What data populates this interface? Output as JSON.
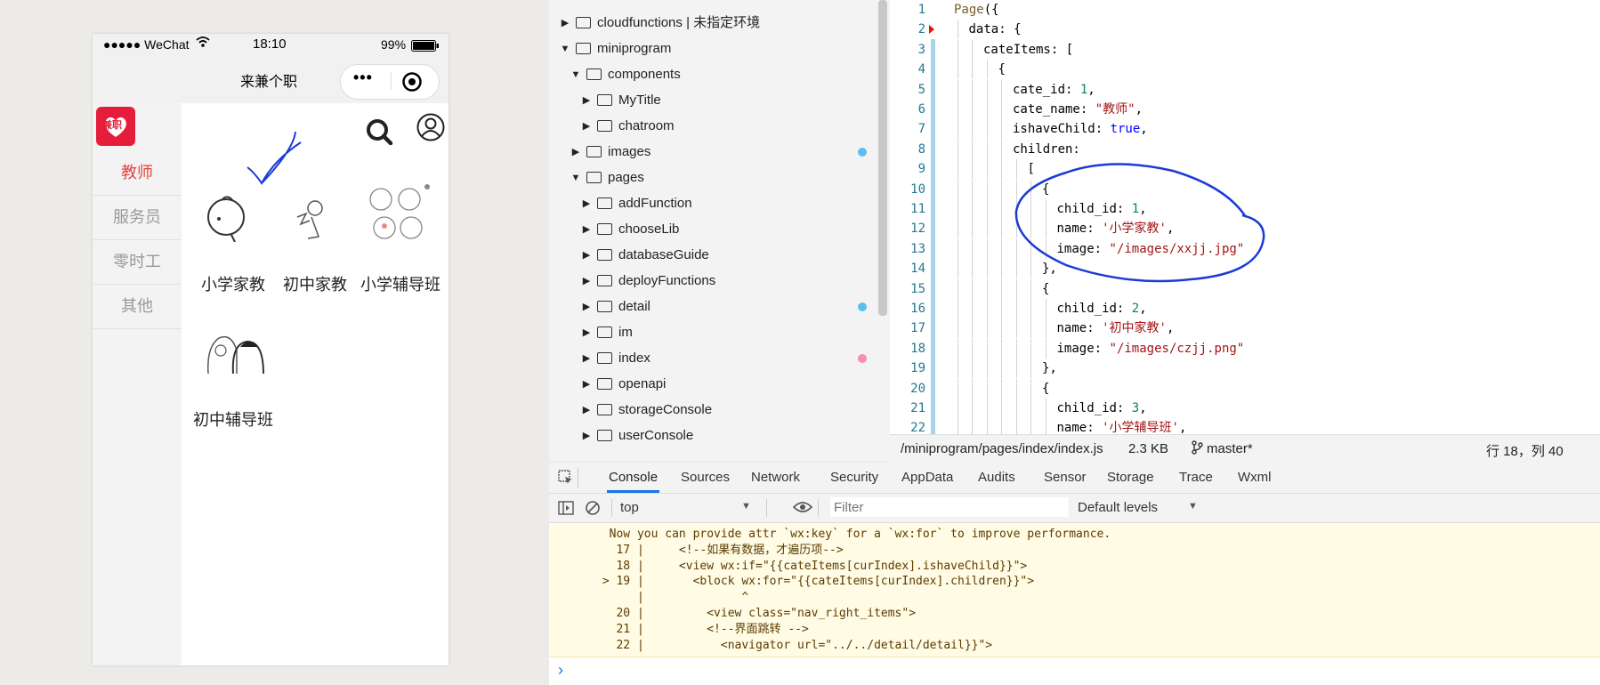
{
  "phone": {
    "status": {
      "carrier": "●●●●● WeChat",
      "time": "18:10",
      "battery": "99%"
    },
    "nav_title": "来兼个职",
    "capsule_more": "•••",
    "logo_text": "兼职",
    "sidebar": [
      "教师",
      "服务员",
      "零时工",
      "其他"
    ],
    "categories": [
      "小学家教",
      "初中家教",
      "小学辅导班",
      "初中辅导班"
    ],
    "colors": {
      "active": "#e64340",
      "inactive": "#999999"
    }
  },
  "tree": {
    "items": [
      {
        "label": "cloudfunctions | 未指定环境",
        "level": 0,
        "expanded": false
      },
      {
        "label": "miniprogram",
        "level": 0,
        "expanded": true
      },
      {
        "label": "components",
        "level": 1,
        "expanded": true
      },
      {
        "label": "MyTitle",
        "level": 2,
        "expanded": false
      },
      {
        "label": "chatroom",
        "level": 2,
        "expanded": false
      },
      {
        "label": "images",
        "level": 1,
        "expanded": false,
        "dot": "#5bc0f0"
      },
      {
        "label": "pages",
        "level": 1,
        "expanded": true
      },
      {
        "label": "addFunction",
        "level": 2,
        "expanded": false
      },
      {
        "label": "chooseLib",
        "level": 2,
        "expanded": false
      },
      {
        "label": "databaseGuide",
        "level": 2,
        "expanded": false
      },
      {
        "label": "deployFunctions",
        "level": 2,
        "expanded": false
      },
      {
        "label": "detail",
        "level": 2,
        "expanded": false,
        "dot": "#5bc0f0"
      },
      {
        "label": "im",
        "level": 2,
        "expanded": false
      },
      {
        "label": "index",
        "level": 2,
        "expanded": false,
        "dot": "#f48fb1"
      },
      {
        "label": "openapi",
        "level": 2,
        "expanded": false
      },
      {
        "label": "storageConsole",
        "level": 2,
        "expanded": false
      },
      {
        "label": "userConsole",
        "level": 2,
        "expanded": false
      }
    ]
  },
  "editor": {
    "lines": [
      {
        "num": "1",
        "indent": 0,
        "t": [
          [
            "fn",
            "Page"
          ],
          [
            "",
            "({"
          ]
        ]
      },
      {
        "num": "2",
        "indent": 1,
        "t": [
          [
            "",
            "data: {"
          ]
        ]
      },
      {
        "num": "3",
        "indent": 2,
        "t": [
          [
            "",
            "cateItems: ["
          ]
        ]
      },
      {
        "num": "4",
        "indent": 3,
        "t": [
          [
            "",
            "{"
          ]
        ]
      },
      {
        "num": "5",
        "indent": 4,
        "t": [
          [
            "",
            "cate_id: "
          ],
          [
            "n",
            "1"
          ],
          [
            "",
            ","
          ]
        ]
      },
      {
        "num": "6",
        "indent": 4,
        "t": [
          [
            "",
            "cate_name: "
          ],
          [
            "s",
            "\"教师\""
          ],
          [
            "",
            ","
          ]
        ]
      },
      {
        "num": "7",
        "indent": 4,
        "t": [
          [
            "",
            "ishaveChild: "
          ],
          [
            "k",
            "true"
          ],
          [
            "",
            ","
          ]
        ]
      },
      {
        "num": "8",
        "indent": 4,
        "t": [
          [
            "",
            "children:"
          ]
        ]
      },
      {
        "num": "9",
        "indent": 5,
        "t": [
          [
            "",
            "["
          ]
        ]
      },
      {
        "num": "10",
        "indent": 6,
        "t": [
          [
            "",
            "{"
          ]
        ]
      },
      {
        "num": "11",
        "indent": 7,
        "t": [
          [
            "",
            "child_id: "
          ],
          [
            "n",
            "1"
          ],
          [
            "",
            ","
          ]
        ]
      },
      {
        "num": "12",
        "indent": 7,
        "t": [
          [
            "",
            "name: "
          ],
          [
            "s",
            "'小学家教'"
          ],
          [
            "",
            ","
          ]
        ]
      },
      {
        "num": "13",
        "indent": 7,
        "t": [
          [
            "",
            "image: "
          ],
          [
            "s",
            "\"/images/xxjj.jpg\""
          ]
        ]
      },
      {
        "num": "14",
        "indent": 6,
        "t": [
          [
            "",
            "},"
          ]
        ]
      },
      {
        "num": "15",
        "indent": 6,
        "t": [
          [
            "",
            "{"
          ]
        ]
      },
      {
        "num": "16",
        "indent": 7,
        "t": [
          [
            "",
            "child_id: "
          ],
          [
            "n",
            "2"
          ],
          [
            "",
            ","
          ]
        ]
      },
      {
        "num": "17",
        "indent": 7,
        "t": [
          [
            "",
            "name: "
          ],
          [
            "s",
            "'初中家教'"
          ],
          [
            "",
            ","
          ]
        ]
      },
      {
        "num": "18",
        "indent": 7,
        "t": [
          [
            "",
            "image: "
          ],
          [
            "s",
            "\"/images/czjj.png\""
          ]
        ]
      },
      {
        "num": "19",
        "indent": 6,
        "t": [
          [
            "",
            "},"
          ]
        ]
      },
      {
        "num": "20",
        "indent": 6,
        "t": [
          [
            "",
            "{"
          ]
        ]
      },
      {
        "num": "21",
        "indent": 7,
        "t": [
          [
            "",
            "child_id: "
          ],
          [
            "n",
            "3"
          ],
          [
            "",
            ","
          ]
        ]
      },
      {
        "num": "22",
        "indent": 7,
        "t": [
          [
            "",
            "name: "
          ],
          [
            "s",
            "'小学辅导班'"
          ],
          [
            "",
            ","
          ]
        ]
      }
    ]
  },
  "statusline": {
    "path": "/miniprogram/pages/index/index.js",
    "size": "2.3 KB",
    "branch": "master*",
    "position": "行 18，列 40"
  },
  "devtools": {
    "tabs": [
      "Console",
      "Sources",
      "Network",
      "Security",
      "AppData",
      "Audits",
      "Sensor",
      "Storage",
      "Trace",
      "Wxml"
    ],
    "active_tab": "Console",
    "context": "top",
    "filter_placeholder": "Filter",
    "levels": "Default levels",
    "console_lines": [
      "  Now you can provide attr `wx:key` for a `wx:for` to improve performance.",
      "   17 |     <!--如果有数据，才遍历项-->",
      "   18 |     <view wx:if=\"{{cateItems[curIndex].ishaveChild}}\">",
      " > 19 |       <block wx:for=\"{{cateItems[curIndex].children}}\">",
      "      |              ^",
      "   20 |         <view class=\"nav_right_items\">",
      "   21 |         <!--界面跳转 -->",
      "   22 |           <navigator url=\"../../detail/detail}}\">"
    ],
    "prompt": "›"
  }
}
